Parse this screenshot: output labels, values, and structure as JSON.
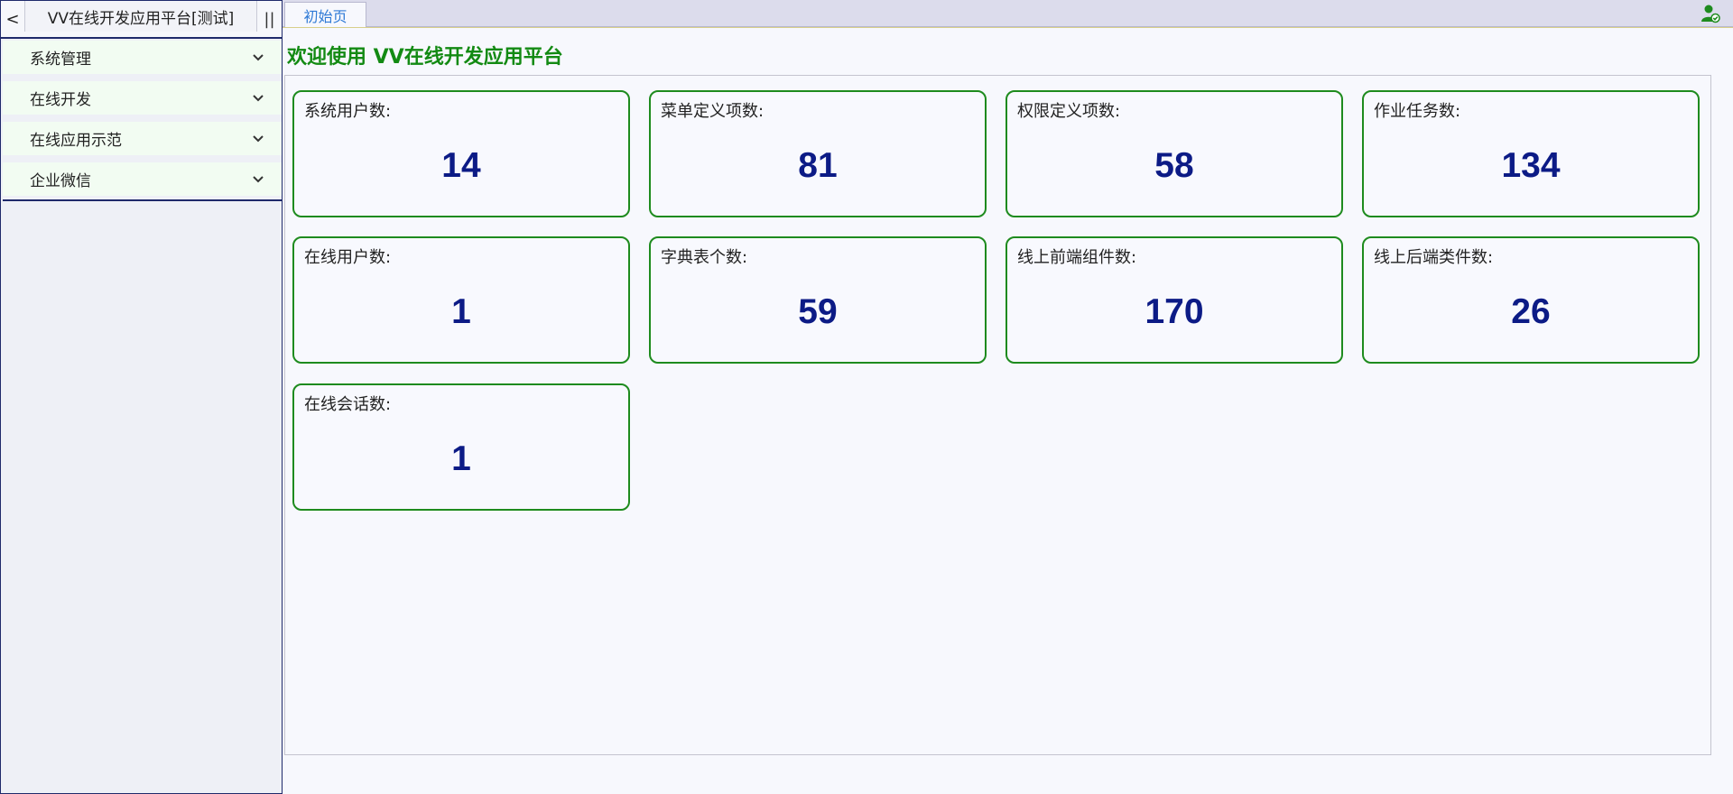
{
  "sidebar": {
    "collapse_symbol": "<",
    "title": "VV在线开发应用平台[测试]",
    "split_symbol": "||",
    "items": [
      {
        "label": "系统管理"
      },
      {
        "label": "在线开发"
      },
      {
        "label": "在线应用示范"
      },
      {
        "label": "企业微信"
      }
    ]
  },
  "tabs": [
    {
      "label": "初始页"
    }
  ],
  "header": {
    "user_icon": "user-status-icon"
  },
  "main": {
    "welcome": "欢迎使用 VV在线开发应用平台",
    "cards": [
      {
        "label": "系统用户数:",
        "value": "14"
      },
      {
        "label": "菜单定义项数:",
        "value": "81"
      },
      {
        "label": "权限定义项数:",
        "value": "58"
      },
      {
        "label": "作业任务数:",
        "value": "134"
      },
      {
        "label": "在线用户数:",
        "value": "1"
      },
      {
        "label": "字典表个数:",
        "value": "59"
      },
      {
        "label": "线上前端组件数:",
        "value": "170"
      },
      {
        "label": "线上后端类件数:",
        "value": "26"
      },
      {
        "label": "在线会话数:",
        "value": "1"
      }
    ]
  },
  "colors": {
    "accent_green": "#138a13",
    "value_blue": "#0c1b86",
    "tab_blue": "#2f7ad6",
    "sidebar_border": "#1f2a6b"
  }
}
